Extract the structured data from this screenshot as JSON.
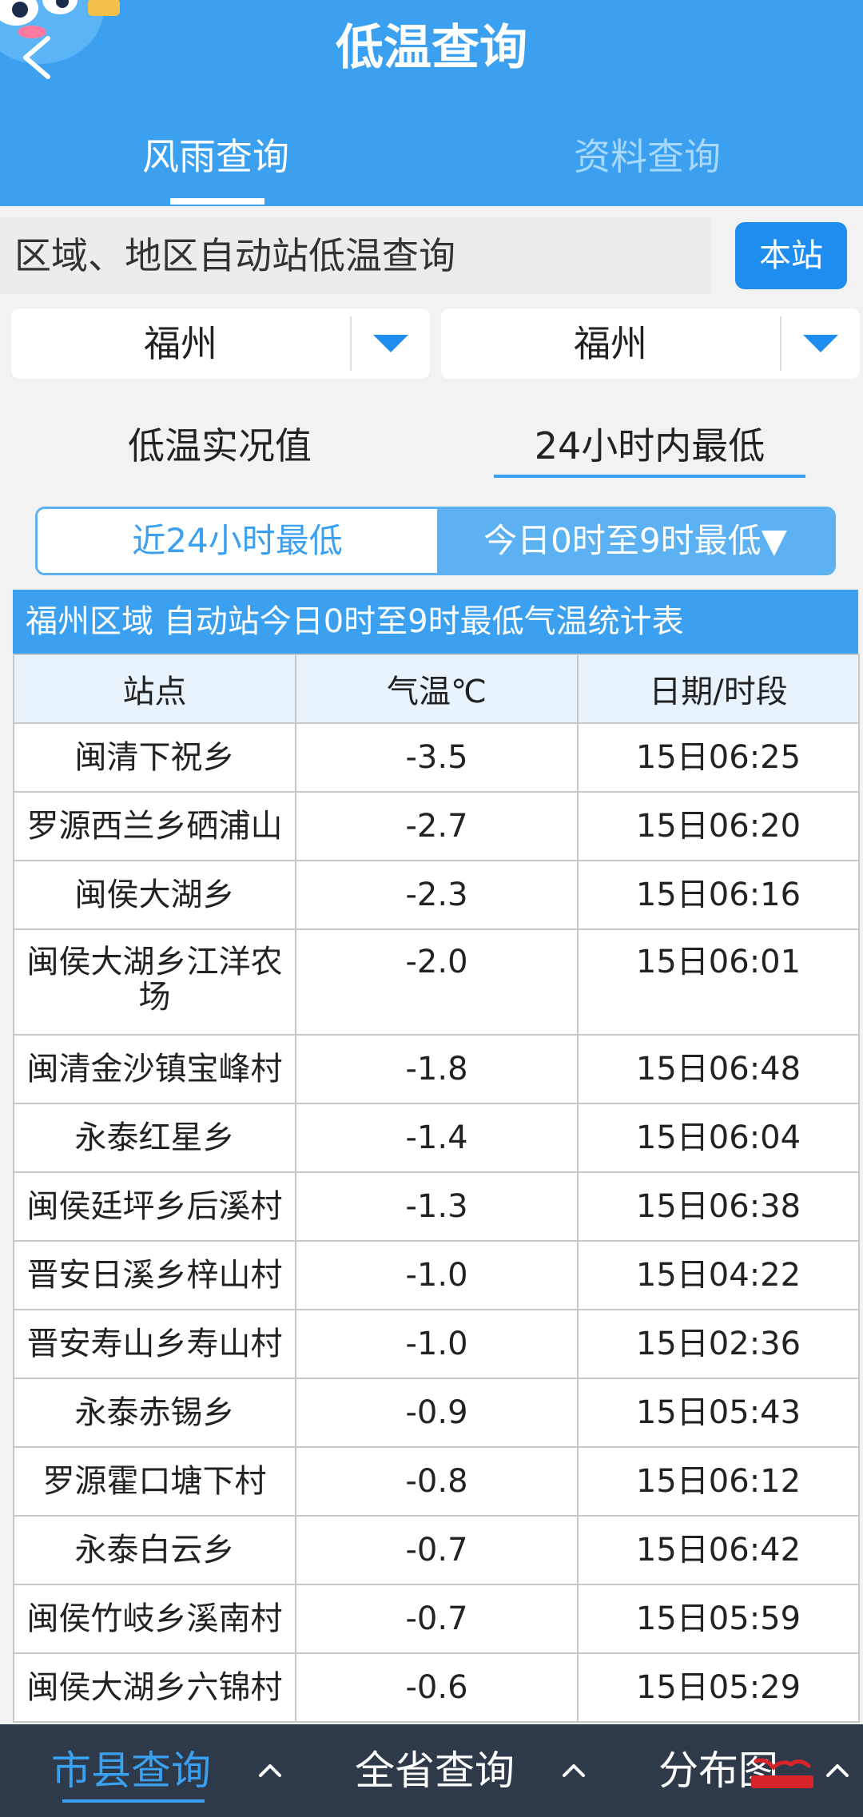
{
  "header": {
    "title": "低温查询",
    "tabs": [
      {
        "label": "风雨查询",
        "active": true
      },
      {
        "label": "资料查询",
        "active": false
      }
    ]
  },
  "query": {
    "label": "区域、地区自动站低温查询",
    "local_button": "本站"
  },
  "dropdowns": [
    {
      "value": "福州"
    },
    {
      "value": "福州"
    }
  ],
  "modes": {
    "realtime": "低温实况值",
    "min24": "24小时内最低"
  },
  "segmented": {
    "left": "近24小时最低",
    "right": "今日0时至9时最低▼"
  },
  "table": {
    "title": "福州区域 自动站今日0时至9时最低气温统计表",
    "headers": [
      "站点",
      "气温℃",
      "日期/时段"
    ],
    "rows": [
      [
        "闽清下祝乡",
        "-3.5",
        "15日06:25"
      ],
      [
        "罗源西兰乡硒浦山",
        "-2.7",
        "15日06:20"
      ],
      [
        "闽侯大湖乡",
        "-2.3",
        "15日06:16"
      ],
      [
        "闽侯大湖乡江洋农场",
        "-2.0",
        "15日06:01"
      ],
      [
        "闽清金沙镇宝峰村",
        "-1.8",
        "15日06:48"
      ],
      [
        "永泰红星乡",
        "-1.4",
        "15日06:04"
      ],
      [
        "闽侯廷坪乡后溪村",
        "-1.3",
        "15日06:38"
      ],
      [
        "晋安日溪乡梓山村",
        "-1.0",
        "15日04:22"
      ],
      [
        "晋安寿山乡寿山村",
        "-1.0",
        "15日02:36"
      ],
      [
        "永泰赤锡乡",
        "-0.9",
        "15日05:43"
      ],
      [
        "罗源霍口塘下村",
        "-0.8",
        "15日06:12"
      ],
      [
        "永泰白云乡",
        "-0.7",
        "15日06:42"
      ],
      [
        "闽侯竹岐乡溪南村",
        "-0.7",
        "15日05:59"
      ],
      [
        "闽侯大湖乡六锦村",
        "-0.6",
        "15日05:29"
      ]
    ]
  },
  "bottom_nav": {
    "items": [
      {
        "label": "市县查询",
        "active": true
      },
      {
        "label": "全省查询",
        "active": false
      },
      {
        "label": "分布图",
        "active": false
      }
    ]
  },
  "colors": {
    "header_bg": "#3aa0ef",
    "button_bg": "#1f8df0",
    "nav_bg": "#2e3a4a"
  },
  "icons": [
    "back-icon",
    "dropdown-arrow-icon",
    "chevron-up-icon",
    "mascot-icon"
  ]
}
